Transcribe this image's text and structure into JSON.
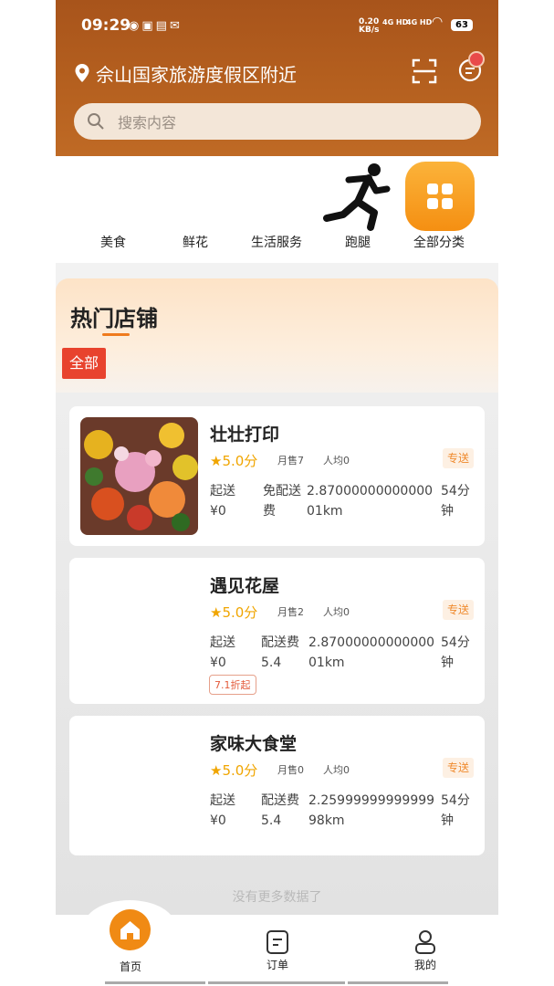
{
  "status_bar": {
    "time": "09:29",
    "notif_icons": [
      "wechat-icon",
      "image-icon",
      "taobao-icon",
      "mail-icon"
    ],
    "speed_top": "0.20",
    "speed_unit": "KB/s",
    "net1": "4G HD",
    "net2": "4G HD",
    "battery": "63"
  },
  "header": {
    "location": "佘山国家旅游度假区附近",
    "search_placeholder": "搜索内容",
    "accent_color": "#b5601f"
  },
  "categories": [
    {
      "label": "美食"
    },
    {
      "label": "鲜花"
    },
    {
      "label": "生活服务"
    },
    {
      "label": "跑腿",
      "icon": "runner-icon"
    },
    {
      "label": "全部分类",
      "icon": "grid-icon"
    }
  ],
  "hot_section": {
    "title": "热门店铺",
    "filter_all": "全部"
  },
  "shops": [
    {
      "name": "壮壮打印",
      "rating": "5.0分",
      "sold": "月售7",
      "avg": "人均0",
      "tag": "专送",
      "min_label": "起送",
      "min_value": "¥0",
      "fee_label": "免配送",
      "fee_value": "费",
      "dist_top": "2.87000000000000",
      "dist_bottom": "01km",
      "time_top": "54分",
      "time_bottom": "钟",
      "discount": ""
    },
    {
      "name": "遇见花屋",
      "rating": "5.0分",
      "sold": "月售2",
      "avg": "人均0",
      "tag": "专送",
      "min_label": "起送",
      "min_value": "¥0",
      "fee_label": "配送费",
      "fee_value": "5.4",
      "dist_top": "2.87000000000000",
      "dist_bottom": "01km",
      "time_top": "54分",
      "time_bottom": "钟",
      "discount": "7.1折起"
    },
    {
      "name": "家味大食堂",
      "rating": "5.0分",
      "sold": "月售0",
      "avg": "人均0",
      "tag": "专送",
      "min_label": "起送",
      "min_value": "¥0",
      "fee_label": "配送费",
      "fee_value": "5.4",
      "dist_top": "2.25999999999999",
      "dist_bottom": "98km",
      "time_top": "54分",
      "time_bottom": "钟",
      "discount": ""
    }
  ],
  "footer_note": "没有更多数据了",
  "tabbar": [
    {
      "label": "首页",
      "icon": "home-icon"
    },
    {
      "label": "订单",
      "icon": "order-icon"
    },
    {
      "label": "我的",
      "icon": "profile-icon"
    }
  ]
}
